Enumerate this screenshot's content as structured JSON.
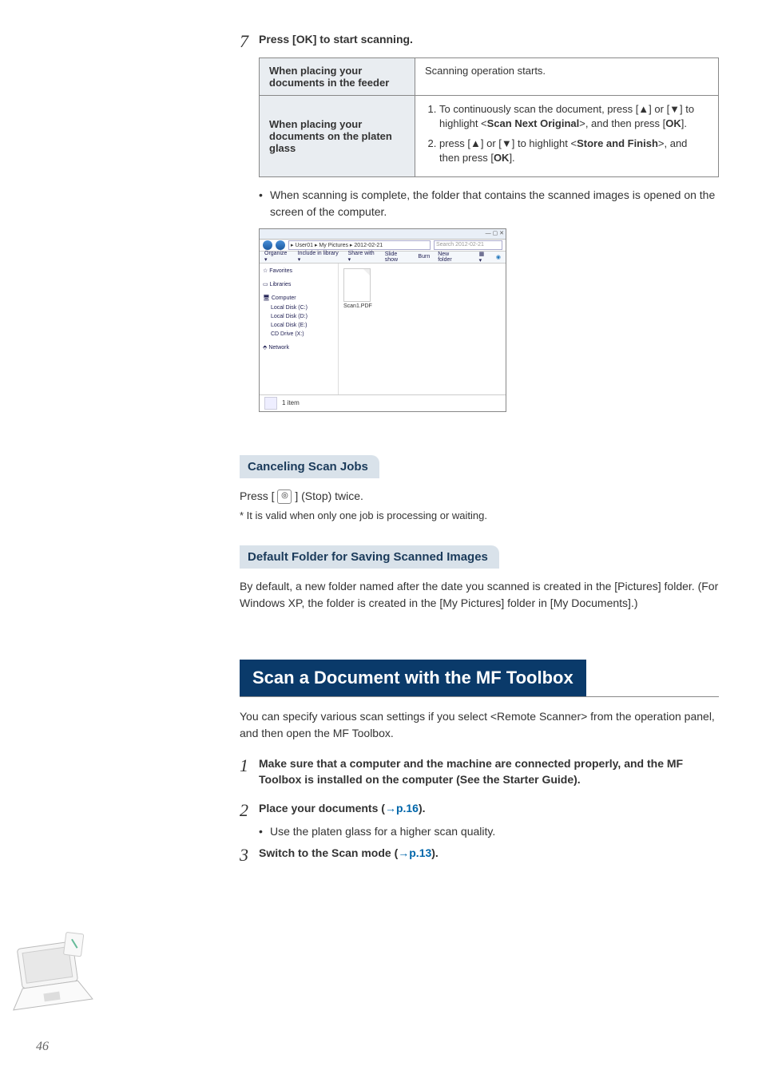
{
  "step7": {
    "num": "7",
    "title": "Press [OK] to start scanning.",
    "table": {
      "row1_header": "When placing your documents in the feeder",
      "row1_body": "Scanning operation starts.",
      "row2_header": "When placing your documents on the platen glass",
      "row2_li1_a": "To continuously scan the document, press [▲] or [▼] to highlight <",
      "row2_li1_b": "Scan Next Original",
      "row2_li1_c": ">, and then press [",
      "row2_li1_d": "OK",
      "row2_li1_e": "].",
      "row2_li2_a": "press [▲] or [▼] to highlight <",
      "row2_li2_b": "Store and Finish",
      "row2_li2_c": ">, and then press [",
      "row2_li2_d": "OK",
      "row2_li2_e": "]."
    },
    "bullet": "When scanning is complete, the folder that contains the scanned images is opened on the screen of the computer."
  },
  "explorer": {
    "path": "▸ User01 ▸ My Pictures ▸ 2012-02-21",
    "search_placeholder": "Search 2012-02-21",
    "toolbar": {
      "organize": "Organize ▾",
      "include": "Include in library ▾",
      "share": "Share with ▾",
      "slide": "Slide show",
      "burn": "Burn",
      "newfolder": "New folder"
    },
    "nav": {
      "favorites": "☆ Favorites",
      "libraries": "▭ Libraries",
      "computer": "🖥 Computer",
      "c": "Local Disk (C:)",
      "d": "Local Disk (D:)",
      "e": "Local Disk (E:)",
      "x": "CD Drive (X:)",
      "network": "⬘ Network"
    },
    "file_label": "Scan1.PDF",
    "status": "1 item"
  },
  "cancel": {
    "heading": "Canceling Scan Jobs",
    "body_a": "Press [ ",
    "body_b": " ] (Stop) twice.",
    "footnote": "*  It is valid when only one job is processing  or waiting."
  },
  "default_folder": {
    "heading": "Default Folder for Saving Scanned Images",
    "body": "By default, a new folder named after the date you scanned is created in the [Pictures] folder. (For Windows XP, the folder is created in the [My Pictures] folder in [My Documents].)"
  },
  "mf": {
    "heading": "Scan a Document with the MF Toolbox",
    "intro": "You can specify various scan settings if you select <Remote Scanner> from the operation panel, and then open the MF Toolbox.",
    "step1_num": "1",
    "step1": "Make sure that a computer and the machine are connected properly, and the MF Toolbox is installed on the computer (See the Starter Guide).",
    "step2_num": "2",
    "step2_a": "Place your documents (",
    "step2_b": "→p.16",
    "step2_c": ").",
    "step2_bullet": "Use the platen glass for a higher scan quality.",
    "step3_num": "3",
    "step3_a": "Switch to the Scan mode (",
    "step3_b": "→p.13",
    "step3_c": ")."
  },
  "page_number": "46"
}
